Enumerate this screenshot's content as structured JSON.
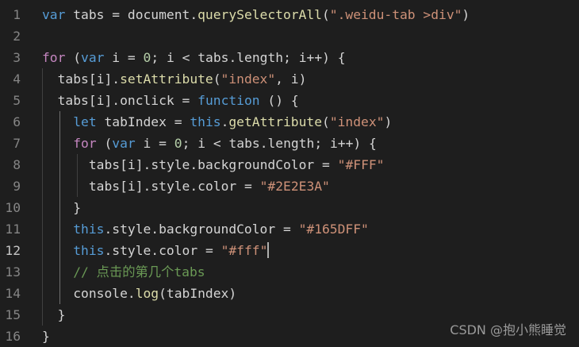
{
  "editor": {
    "lines": [
      {
        "num": "1",
        "text": "var tabs = document.querySelectorAll(\".weidu-tab >div\")"
      },
      {
        "num": "2",
        "text": ""
      },
      {
        "num": "3",
        "text": "for (var i = 0; i < tabs.length; i++) {"
      },
      {
        "num": "4",
        "text": "  tabs[i].setAttribute(\"index\", i)"
      },
      {
        "num": "5",
        "text": "  tabs[i].onclick = function () {"
      },
      {
        "num": "6",
        "text": "    let tabIndex = this.getAttribute(\"index\")"
      },
      {
        "num": "7",
        "text": "    for (var i = 0; i < tabs.length; i++) {"
      },
      {
        "num": "8",
        "text": "      tabs[i].style.backgroundColor = \"#FFF\""
      },
      {
        "num": "9",
        "text": "      tabs[i].style.color = \"#2E2E3A\""
      },
      {
        "num": "10",
        "text": "    }"
      },
      {
        "num": "11",
        "text": "    this.style.backgroundColor = \"#165DFF\""
      },
      {
        "num": "12",
        "text": "    this.style.color = \"#fff\""
      },
      {
        "num": "13",
        "text": "    // 点击的第几个tabs"
      },
      {
        "num": "14",
        "text": "    console.log(tabIndex)"
      },
      {
        "num": "15",
        "text": "  }"
      },
      {
        "num": "16",
        "text": "}"
      }
    ],
    "current_line": "12"
  },
  "watermark": "CSDN @抱小熊睡觉",
  "colors": {
    "background": "#1e1e1e",
    "keyword": "#569cd6",
    "control": "#c586c0",
    "string": "#ce9178",
    "number": "#b5cea8",
    "comment": "#6a9955",
    "function": "#dcdcaa",
    "identifier": "#d4d4d4",
    "line_number": "#858585"
  }
}
